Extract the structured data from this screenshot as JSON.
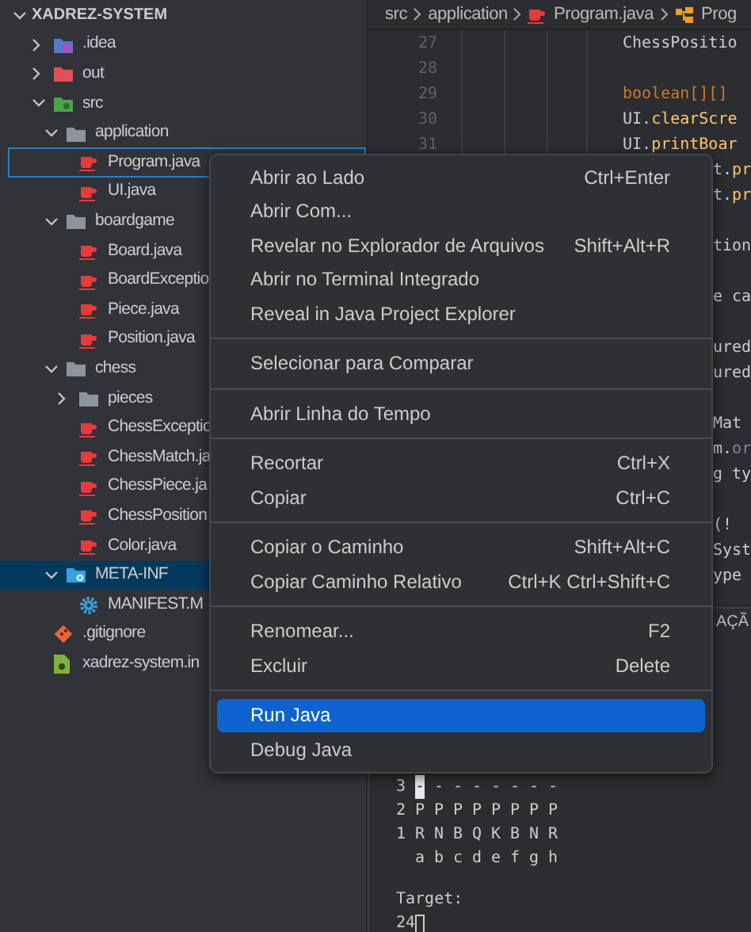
{
  "explorer": {
    "title": "XADREZ-SYSTEM",
    "expanded": true,
    "items": [
      {
        "label": ".idea",
        "kind": "folder-idea",
        "expanded": false,
        "selected": false,
        "focused": false
      },
      {
        "label": "out",
        "kind": "folder-out",
        "expanded": false,
        "selected": false,
        "focused": false
      },
      {
        "label": "src",
        "kind": "folder-src",
        "expanded": true,
        "selected": false,
        "focused": false,
        "children": [
          {
            "label": "application",
            "kind": "folder",
            "expanded": true,
            "selected": false,
            "focused": false,
            "children": [
              {
                "label": "Program.java",
                "kind": "java",
                "selected": false,
                "focused": true
              },
              {
                "label": "UI.java",
                "kind": "java",
                "selected": false,
                "focused": false
              }
            ]
          },
          {
            "label": "boardgame",
            "kind": "folder",
            "expanded": true,
            "selected": false,
            "focused": false,
            "children": [
              {
                "label": "Board.java",
                "kind": "java",
                "selected": false,
                "focused": false
              },
              {
                "label": "BoardExceptio",
                "kind": "java",
                "selected": false,
                "focused": false
              },
              {
                "label": "Piece.java",
                "kind": "java",
                "selected": false,
                "focused": false
              },
              {
                "label": "Position.java",
                "kind": "java",
                "selected": false,
                "focused": false
              }
            ]
          },
          {
            "label": "chess",
            "kind": "folder",
            "expanded": true,
            "selected": false,
            "focused": false,
            "children": [
              {
                "label": "pieces",
                "kind": "folder",
                "expanded": false,
                "selected": false,
                "focused": false
              },
              {
                "label": "ChessExceptio",
                "kind": "java",
                "selected": false,
                "focused": false
              },
              {
                "label": "ChessMatch.ja",
                "kind": "java",
                "selected": false,
                "focused": false
              },
              {
                "label": "ChessPiece.ja",
                "kind": "java",
                "selected": false,
                "focused": false
              },
              {
                "label": "ChessPosition",
                "kind": "java",
                "selected": false,
                "focused": false
              },
              {
                "label": "Color.java",
                "kind": "java",
                "selected": false,
                "focused": false
              }
            ]
          },
          {
            "label": "META-INF",
            "kind": "folder-meta",
            "expanded": true,
            "selected": true,
            "focused": false,
            "children": [
              {
                "label": "MANIFEST.M",
                "kind": "gear",
                "selected": false,
                "focused": false
              }
            ]
          }
        ]
      },
      {
        "label": ".gitignore",
        "kind": "git",
        "selected": false,
        "focused": false
      },
      {
        "label": "xadrez-system.in",
        "kind": "module",
        "selected": false,
        "focused": false
      }
    ]
  },
  "breadcrumb": [
    {
      "label": "src",
      "kind": "folder"
    },
    {
      "label": "application",
      "kind": "folder"
    },
    {
      "label": "Program.java",
      "kind": "java"
    },
    {
      "label": "Prog",
      "kind": "class"
    }
  ],
  "editor": {
    "lines": [
      {
        "kind": "full",
        "number": "27",
        "tokens": [
          {
            "text": "ChessPositio",
            "kind": "plain"
          }
        ]
      },
      {
        "kind": "full",
        "number": "28"
      },
      {
        "kind": "full",
        "number": "29",
        "tokens": [
          {
            "text": "boolean[][]",
            "kind": "keyword"
          }
        ]
      },
      {
        "kind": "full",
        "number": "30",
        "tokens": [
          {
            "text": "UI.",
            "kind": "plain"
          },
          {
            "text": "clearScre",
            "kind": "method"
          }
        ]
      },
      {
        "kind": "full",
        "number": "31",
        "tokens": [
          {
            "text": "UI.",
            "kind": "plain"
          },
          {
            "text": "printBoar",
            "kind": "method"
          }
        ]
      },
      {
        "kind": "clipped",
        "tokens": [
          {
            "text": "t.",
            "kind": "plain"
          },
          {
            "text": "pr",
            "kind": "method"
          }
        ]
      },
      {
        "kind": "clipped",
        "tokens": [
          {
            "text": "t.",
            "kind": "plain"
          },
          {
            "text": "pr",
            "kind": "method"
          }
        ]
      },
      {
        "kind": "blank"
      },
      {
        "kind": "clipped",
        "tokens": [
          {
            "text": "tion",
            "kind": "plain"
          }
        ]
      },
      {
        "kind": "blank"
      },
      {
        "kind": "clipped",
        "tokens": [
          {
            "text": "e ca",
            "kind": "plain"
          }
        ]
      },
      {
        "kind": "blank"
      },
      {
        "kind": "clipped",
        "tokens": [
          {
            "text": "ured",
            "kind": "plain"
          }
        ]
      },
      {
        "kind": "clipped",
        "tokens": [
          {
            "text": "ured",
            "kind": "plain"
          }
        ]
      },
      {
        "kind": "blank"
      },
      {
        "kind": "clipped",
        "tokens": [
          {
            "text": "Mat",
            "kind": "plain"
          }
        ]
      },
      {
        "kind": "clipped",
        "tokens": [
          {
            "text": "m.",
            "kind": "plain"
          },
          {
            "text": "or",
            "kind": "field"
          }
        ]
      },
      {
        "kind": "clipped",
        "tokens": [
          {
            "text": "g ty",
            "kind": "plain"
          }
        ]
      },
      {
        "kind": "blank"
      },
      {
        "kind": "clipped",
        "tokens": [
          {
            "text": "(!",
            "kind": "plain"
          }
        ]
      },
      {
        "kind": "clipped",
        "tokens": [
          {
            "text": "Syst",
            "kind": "plain"
          }
        ]
      },
      {
        "kind": "clipped",
        "tokens": [
          {
            "text": "ype",
            "kind": "plain"
          }
        ]
      }
    ]
  },
  "panel": {
    "tab": "AÇÃ"
  },
  "terminal": {
    "board": [
      {
        "rank": "3",
        "cells": [
          {
            "text": "-",
            "highlighted": true
          },
          {
            "text": "-",
            "highlighted": false
          },
          {
            "text": "-",
            "highlighted": false
          },
          {
            "text": "-",
            "highlighted": false
          },
          {
            "text": "-",
            "highlighted": false
          },
          {
            "text": "-",
            "highlighted": false
          },
          {
            "text": "-",
            "highlighted": false
          },
          {
            "text": "-",
            "highlighted": false
          }
        ]
      },
      {
        "rank": "2",
        "cells": [
          {
            "text": "P",
            "highlighted": false
          },
          {
            "text": "P",
            "highlighted": false
          },
          {
            "text": "P",
            "highlighted": false
          },
          {
            "text": "P",
            "highlighted": false
          },
          {
            "text": "P",
            "highlighted": false
          },
          {
            "text": "P",
            "highlighted": false
          },
          {
            "text": "P",
            "highlighted": false
          },
          {
            "text": "P",
            "highlighted": false
          }
        ]
      },
      {
        "rank": "1",
        "cells": [
          {
            "text": "R",
            "highlighted": false
          },
          {
            "text": "N",
            "highlighted": false
          },
          {
            "text": "B",
            "highlighted": false
          },
          {
            "text": "Q",
            "highlighted": false
          },
          {
            "text": "K",
            "highlighted": false
          },
          {
            "text": "B",
            "highlighted": false
          },
          {
            "text": "N",
            "highlighted": false
          },
          {
            "text": "R",
            "highlighted": false
          }
        ]
      },
      {
        "cells": [
          {
            "text": "a",
            "highlighted": false
          },
          {
            "text": "b",
            "highlighted": false
          },
          {
            "text": "c",
            "highlighted": false
          },
          {
            "text": "d",
            "highlighted": false
          },
          {
            "text": "e",
            "highlighted": false
          },
          {
            "text": "f",
            "highlighted": false
          },
          {
            "text": "g",
            "highlighted": false
          },
          {
            "text": "h",
            "highlighted": false
          }
        ]
      }
    ],
    "prompt": "Target:",
    "input": "24"
  },
  "context_menu": {
    "items": [
      {
        "kind": "item",
        "label": "Abrir ao Lado",
        "shortcut": "Ctrl+Enter",
        "selected": false
      },
      {
        "kind": "item",
        "label": "Abrir Com...",
        "selected": false
      },
      {
        "kind": "item",
        "label": "Revelar no Explorador de Arquivos",
        "shortcut": "Shift+Alt+R",
        "selected": false
      },
      {
        "kind": "item",
        "label": "Abrir no Terminal Integrado",
        "selected": false
      },
      {
        "kind": "item",
        "label": "Reveal in Java Project Explorer",
        "selected": false
      },
      {
        "kind": "separator"
      },
      {
        "kind": "item",
        "label": "Selecionar para Comparar",
        "selected": false
      },
      {
        "kind": "separator"
      },
      {
        "kind": "item",
        "label": "Abrir Linha do Tempo",
        "selected": false
      },
      {
        "kind": "separator"
      },
      {
        "kind": "item",
        "label": "Recortar",
        "shortcut": "Ctrl+X",
        "selected": false
      },
      {
        "kind": "item",
        "label": "Copiar",
        "shortcut": "Ctrl+C",
        "selected": false
      },
      {
        "kind": "separator"
      },
      {
        "kind": "item",
        "label": "Copiar o Caminho",
        "shortcut": "Shift+Alt+C",
        "selected": false
      },
      {
        "kind": "item",
        "label": "Copiar Caminho Relativo",
        "shortcut": "Ctrl+K Ctrl+Shift+C",
        "selected": false
      },
      {
        "kind": "separator"
      },
      {
        "kind": "item",
        "label": "Renomear...",
        "shortcut": "F2",
        "selected": false
      },
      {
        "kind": "item",
        "label": "Excluir",
        "shortcut": "Delete",
        "selected": false
      },
      {
        "kind": "separator"
      },
      {
        "kind": "item",
        "label": "Run Java",
        "selected": true
      },
      {
        "kind": "item",
        "label": "Debug Java",
        "selected": false
      }
    ]
  }
}
